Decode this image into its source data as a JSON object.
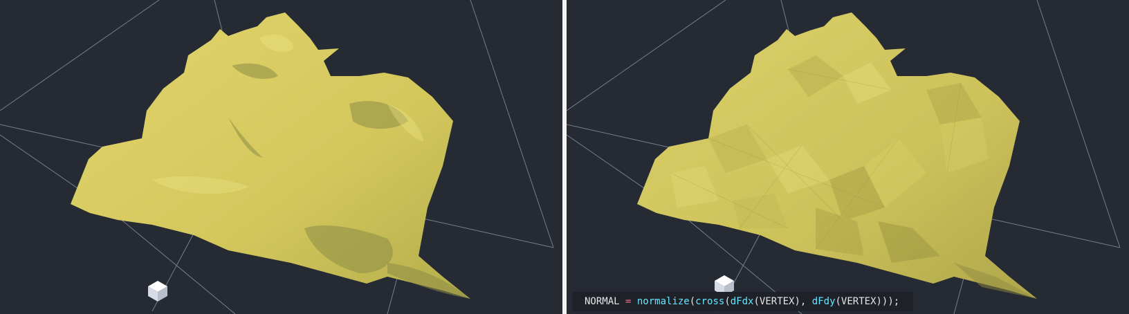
{
  "viewports": [
    {
      "name": "smooth-shading-viewport"
    },
    {
      "name": "flat-shading-viewport"
    }
  ],
  "code_snippet": {
    "tokens": [
      {
        "text": "NORMAL",
        "kind": "id"
      },
      {
        "text": " = ",
        "kind": "op"
      },
      {
        "text": "normalize",
        "kind": "fn"
      },
      {
        "text": "(",
        "kind": "id"
      },
      {
        "text": "cross",
        "kind": "fn"
      },
      {
        "text": "(",
        "kind": "id"
      },
      {
        "text": "dFdx",
        "kind": "fn"
      },
      {
        "text": "(VERTEX), ",
        "kind": "id"
      },
      {
        "text": "dFdy",
        "kind": "fn"
      },
      {
        "text": "(VERTEX)));",
        "kind": "id"
      }
    ]
  },
  "colors": {
    "background": "#262a33",
    "terrain": "#d8cc62",
    "terrain_shadow": "#8d8c45",
    "grid_line": "#8a93a6",
    "divider": "#f4f4f4"
  },
  "icons": [
    "light-gizmo-icon"
  ]
}
